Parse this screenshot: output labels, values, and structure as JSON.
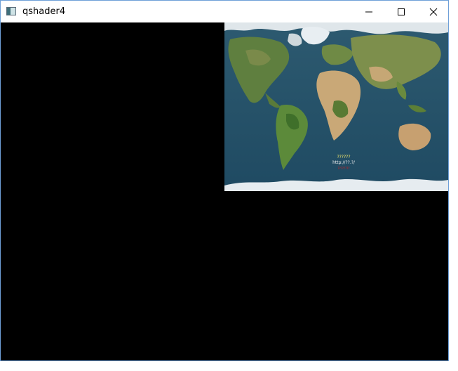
{
  "window": {
    "title": "qshader4",
    "icon": "app-window-icon",
    "controls": [
      "minimize-icon",
      "maximize-icon",
      "close-icon"
    ]
  },
  "texture": {
    "caption_line1": "??????",
    "caption_line2": "http://??.?/",
    "caption_line3": "????????"
  },
  "colors": {
    "background": "#000000",
    "frame": "#6fa0d8",
    "ocean": "#25506a"
  }
}
